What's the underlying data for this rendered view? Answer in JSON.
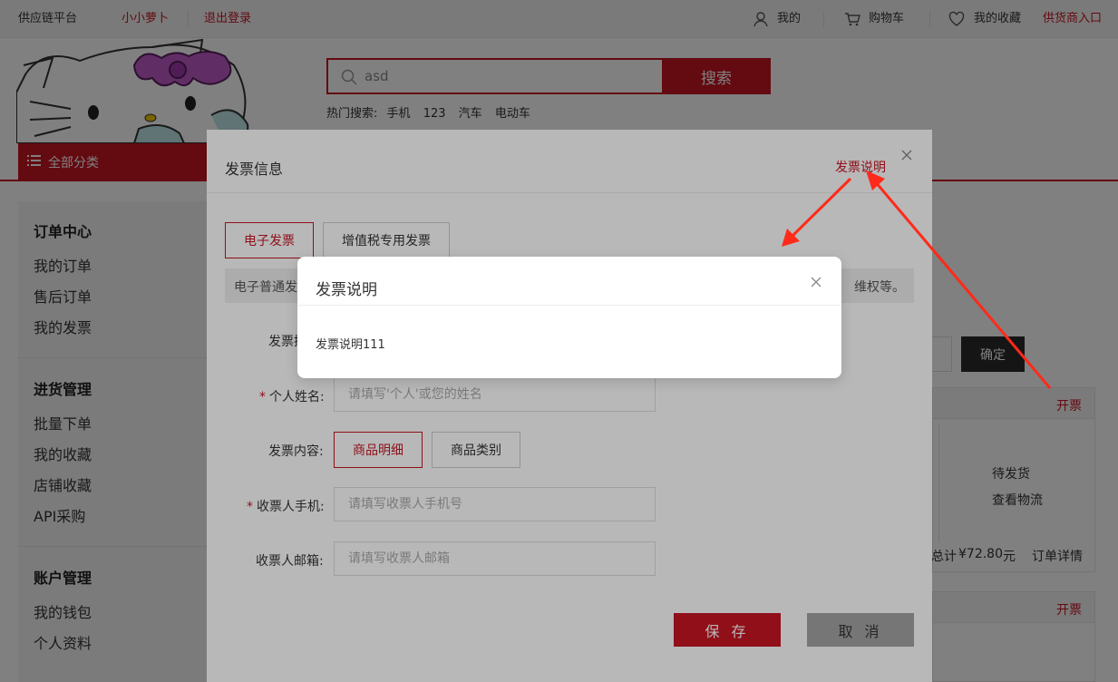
{
  "topbar": {
    "platform": "供应链平台",
    "username": "小小萝卜",
    "logout": "退出登录",
    "mine": "我的",
    "cart": "购物车",
    "favorites": "我的收藏",
    "supplier_entry": "供货商入口",
    "icons": [
      "user-icon",
      "cart-icon",
      "heart-icon"
    ]
  },
  "search": {
    "value": "asd",
    "button": "搜索",
    "hot_label": "热门搜索:",
    "hot_terms": [
      "手机",
      "123",
      "汽车",
      "电动车"
    ]
  },
  "category": {
    "label": "全部分类"
  },
  "sidebar": {
    "sections": [
      {
        "title": "订单中心",
        "items": [
          "我的订单",
          "售后订单",
          "我的发票"
        ]
      },
      {
        "title": "进货管理",
        "items": [
          "批量下单",
          "我的收藏",
          "店铺收藏",
          "API采购"
        ]
      },
      {
        "title": "账户管理",
        "items": [
          "我的钱包",
          "个人资料"
        ]
      }
    ],
    "active_item": "我的发票"
  },
  "main": {
    "confirm": "确定",
    "orders": [
      {
        "action": "开票",
        "status": "待发货",
        "logistics": "查看物流",
        "total_label": "总计:",
        "total": "¥72.80",
        "unit": "元",
        "detail": "订单详情"
      },
      {
        "action": "开票"
      }
    ]
  },
  "invoice_dialog": {
    "title": "发票信息",
    "help_link": "发票说明",
    "tabs": [
      "电子发票",
      "增值税专用发票"
    ],
    "tip_left": "电子普通发",
    "tip_right": "维权等。",
    "fields": {
      "type_label": "发票抬",
      "name_label": "个人姓名:",
      "name_placeholder": "请填写'个人'或您的姓名",
      "content_label": "发票内容:",
      "content_options": [
        "商品明细",
        "商品类别"
      ],
      "phone_label": "收票人手机:",
      "phone_placeholder": "请填写收票人手机号",
      "email_label": "收票人邮箱:",
      "email_placeholder": "请填写收票人邮箱"
    },
    "save": "保 存",
    "cancel": "取 消"
  },
  "help_popup": {
    "title": "发票说明",
    "body": "发票说明111"
  },
  "colors": {
    "brand": "#c81623",
    "arrow": "#ff2a1a"
  }
}
